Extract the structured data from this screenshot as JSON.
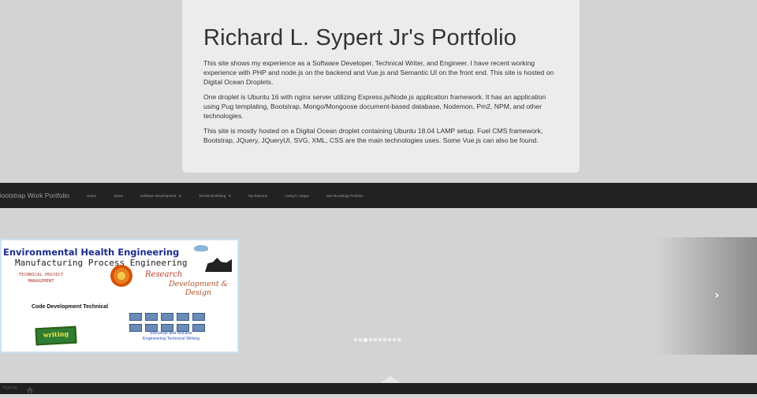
{
  "jumbotron": {
    "title": "Richard L. Sypert Jr's Portfolio",
    "paragraphs": [
      "This site shows my experience as a Software Developer, Technical Writer, and Engineer. I have recent working experience with PHP and node.js on the backend and Vue.js and Semantic UI on the front end. This site is hosted on Digital Ocean Droplets.",
      "One droplet is Ubuntu 16 with nginx server utilizing Express.js/Node.js application framework. It has an application using Pug templating, Bootstrap, Mongo/Mongoose document-based database, Nodemon, Pm2, NPM, and other technologies.",
      "This site is mostly hosted on a Digital Ocean droplet containing Ubuntu 18.04 LAMP setup. Fuel CMS framework, Bootstrap, JQuery, JQueryUI, SVG, XML, CSS are the main technologies uses. Some Vue.js can also be found."
    ]
  },
  "navbar": {
    "brand": "Bootstrap Work Portfolio",
    "items": [
      {
        "label": "Home"
      },
      {
        "label": "About"
      },
      {
        "label": "Software Development",
        "dropdown": true
      },
      {
        "label": "Technical Writing",
        "dropdown": true
      },
      {
        "label": "My Resume"
      },
      {
        "label": "Living In Vegas"
      },
      {
        "label": "Non-Bootstrap Portfolio"
      }
    ],
    "caret_glyph": "▼"
  },
  "carousel": {
    "slide": {
      "title": "Environmental Health Engineering",
      "subtitle": "Manufacturing Process Engineering",
      "tpm": "TECHNICAL PROJECT MANAGEMENT",
      "research": "Research",
      "development": "Development & Design",
      "code": "Code Development Technical",
      "writing": "writing",
      "electrical": "Electrical and Nuclear Engineering Technical Writing"
    },
    "next_glyph": "›",
    "indicator_count": 10,
    "active_index": 2
  },
  "footer": {
    "link_text": "Home",
    "home_icon": "home-icon",
    "back_to_top_icon": "back-to-top-icon"
  },
  "colors": {
    "page_bg": "#d3d3d3",
    "jumbotron_bg": "#ececec",
    "navbar_bg": "#222222",
    "footer_bg": "#1f1f1f"
  }
}
